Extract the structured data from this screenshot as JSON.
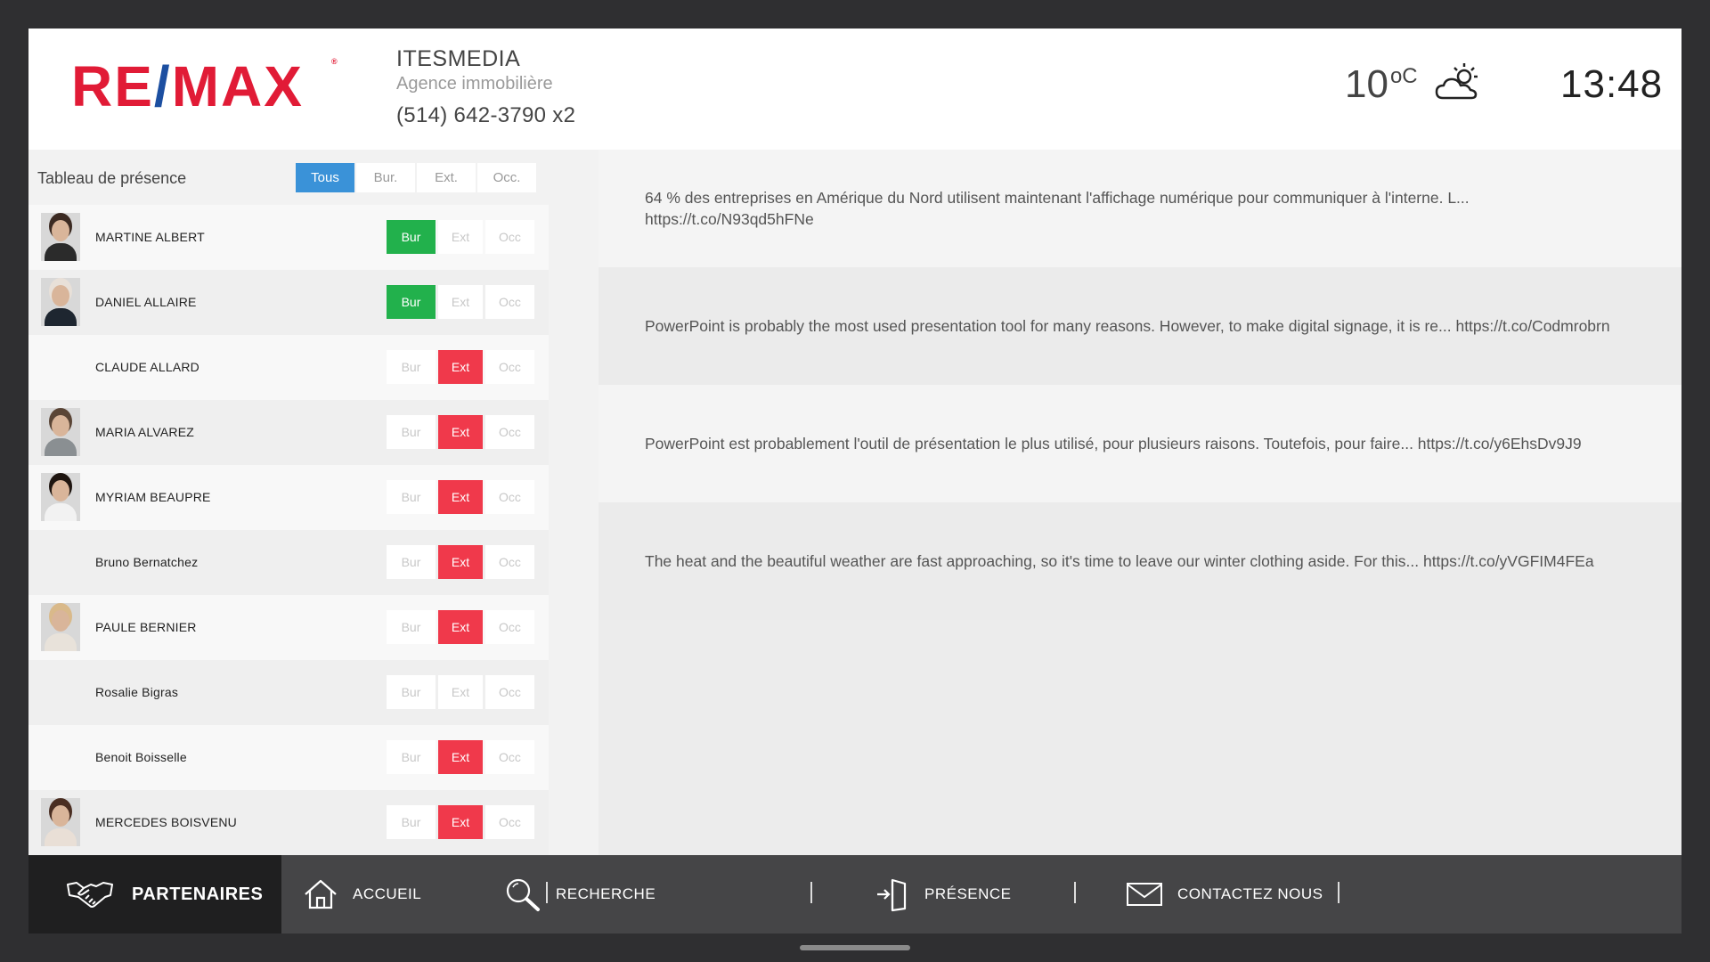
{
  "header": {
    "logo_text": "RE/MAX",
    "company_name": "ITESMEDIA",
    "company_sub": "Agence immobilière",
    "phone": "(514) 642-3790 x2",
    "temperature": "10",
    "temperature_unit": "oC",
    "weather_icon": "partly-cloudy-icon",
    "time": "13:48"
  },
  "presence": {
    "title": "Tableau de présence",
    "filters": [
      "Tous",
      "Bur.",
      "Ext.",
      "Occ."
    ],
    "active_filter": "Tous",
    "status_labels": {
      "bur": "Bur",
      "ext": "Ext",
      "occ": "Occ"
    },
    "people": [
      {
        "name": "MARTINE ALBERT",
        "status": "bur",
        "photo": true,
        "hair": "#3b2a22",
        "shirt": "#2b2b2b"
      },
      {
        "name": "DANIEL ALLAIRE",
        "status": "bur",
        "photo": true,
        "hair": "#e8e0d8",
        "shirt": "#1e2630"
      },
      {
        "name": "CLAUDE ALLARD",
        "status": "ext",
        "photo": false
      },
      {
        "name": "MARIA ALVAREZ",
        "status": "ext",
        "photo": true,
        "hair": "#5a4536",
        "shirt": "#8a8f92"
      },
      {
        "name": "MYRIAM BEAUPRE",
        "status": "ext",
        "photo": true,
        "hair": "#1e1510",
        "shirt": "#f2f2f2"
      },
      {
        "name": "Bruno Bernatchez",
        "status": "ext",
        "photo": false
      },
      {
        "name": "PAULE BERNIER",
        "status": "ext",
        "photo": true,
        "hair": "#d9b98a",
        "shirt": "#e8e2da"
      },
      {
        "name": "Rosalie Bigras",
        "status": "none",
        "photo": false
      },
      {
        "name": "Benoit Boisselle",
        "status": "ext",
        "photo": false
      },
      {
        "name": "MERCEDES BOISVENU",
        "status": "ext",
        "photo": true,
        "hair": "#4a2e22",
        "shirt": "#e9dfd6"
      }
    ]
  },
  "feed": [
    "64 % des entreprises en Amérique du Nord utilisent maintenant l'affichage numérique pour communiquer à l'interne. L... https://t.co/N93qd5hFNe",
    "PowerPoint is probably the most used presentation tool for many reasons. However, to make digital signage, it is re... https://t.co/Codmrobrn",
    "PowerPoint est probablement l'outil de présentation le plus utilisé, pour plusieurs raisons. Toutefois, pour faire... https://t.co/y6EhsDv9J9",
    "The heat and the beautiful weather are fast approaching, so it's time to leave our winter clothing aside. For this... https://t.co/yVGFIM4FEa"
  ],
  "nav": {
    "partners": {
      "label": "PARTENAIRES",
      "icon": "handshake-icon"
    },
    "items": [
      {
        "label": "ACCUEIL",
        "icon": "home-icon"
      },
      {
        "label": "RECHERCHE",
        "icon": "search-icon"
      },
      {
        "label": "PRÉSENCE",
        "icon": "door-enter-icon"
      },
      {
        "label": "CONTACTEZ NOUS",
        "icon": "envelope-icon"
      }
    ]
  },
  "colors": {
    "brand_red": "#e11b36",
    "brand_blue": "#1c4fa1",
    "active_filter": "#3a92d8",
    "status_bur": "#22b14c",
    "status_ext": "#f0394b"
  }
}
